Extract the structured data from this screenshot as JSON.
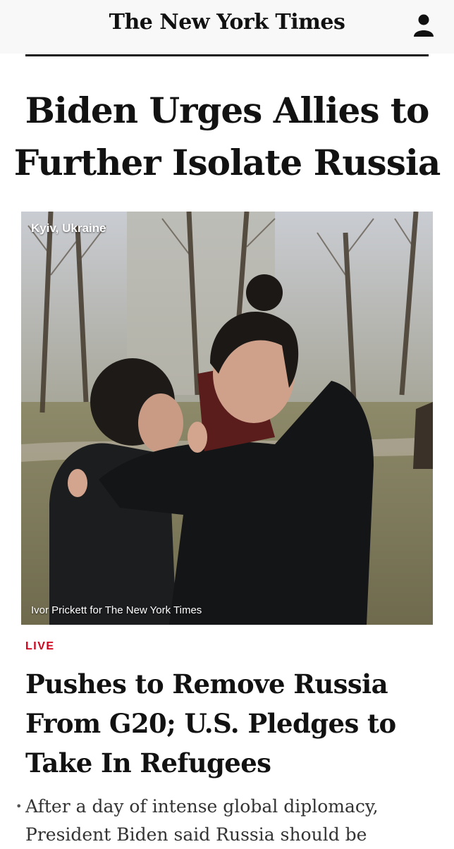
{
  "header": {
    "masthead": "The New York Times",
    "account_icon": "person-icon"
  },
  "article": {
    "headline_line1": "Biden Urges Allies to",
    "headline_line2": "Further Isolate Russia",
    "photo": {
      "location": "Kyiv, Ukraine",
      "credit": "Ivor Prickett for The New York Times"
    },
    "live_label": "LIVE",
    "subhead_line1": "Pushes to Remove Russia",
    "subhead_line2": "From G20; U.S. Pledges to",
    "subhead_line3": "Take In Refugees",
    "summary_line1": "After a day of intense global diplomacy,",
    "summary_line2": "President Biden said Russia should be"
  },
  "colors": {
    "live": "#d0021b",
    "text": "#121212",
    "header_bg": "#f8f8f8"
  }
}
